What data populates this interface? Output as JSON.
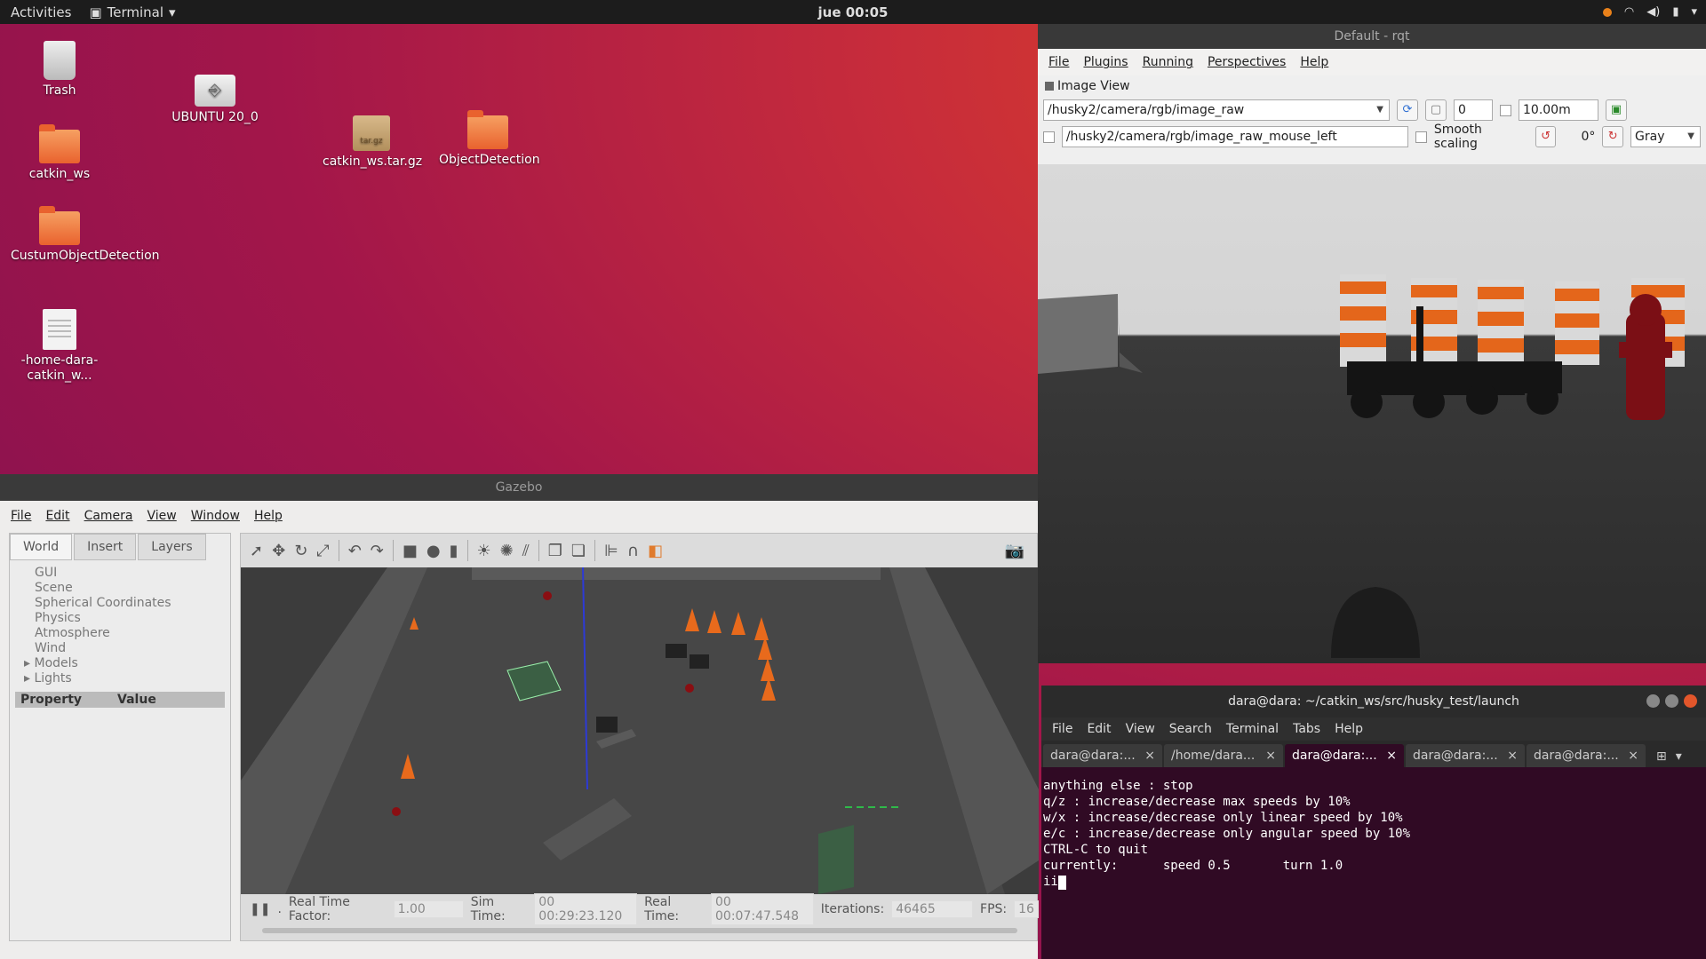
{
  "topbar": {
    "activities": "Activities",
    "app_name": "Terminal",
    "clock": "jue 00:05"
  },
  "desktop": {
    "icons": [
      {
        "label": "Trash"
      },
      {
        "label": "UBUNTU 20_0"
      },
      {
        "label": "catkin_ws.tar.gz"
      },
      {
        "label": "ObjectDetection"
      },
      {
        "label": "catkin_ws"
      },
      {
        "label": "CustumObjectDetection"
      },
      {
        "label": "-home-dara-catkin_w..."
      }
    ],
    "archive_badge": "tar.gz"
  },
  "rqt": {
    "title": "Default - rqt",
    "menu": [
      "File",
      "Plugins",
      "Running",
      "Perspectives",
      "Help"
    ],
    "plugin_title": "Image View",
    "topic": "/husky2/camera/rgb/image_raw",
    "spin_value": "0",
    "max_range": "10.00m",
    "mouse_topic": "/husky2/camera/rgb/image_raw_mouse_left",
    "smooth_scaling": "Smooth scaling",
    "rotation": "0°",
    "color_scheme": "Gray"
  },
  "gazebo": {
    "title": "Gazebo",
    "menu": [
      "File",
      "Edit",
      "Camera",
      "View",
      "Window",
      "Help"
    ],
    "tabs": [
      "World",
      "Insert",
      "Layers"
    ],
    "tree": [
      "GUI",
      "Scene",
      "Spherical Coordinates",
      "Physics",
      "Atmosphere",
      "Wind",
      "Models",
      "Lights"
    ],
    "prop_headers": [
      "Property",
      "Value"
    ],
    "status": {
      "rtf_label": "Real Time Factor:",
      "rtf": "1.00",
      "sim_label": "Sim Time:",
      "sim": "00 00:29:23.120",
      "real_label": "Real Time:",
      "real": "00 00:07:47.548",
      "iter_label": "Iterations:",
      "iter": "46465",
      "fps_label": "FPS:",
      "fps": "16"
    }
  },
  "terminal": {
    "title": "dara@dara: ~/catkin_ws/src/husky_test/launch",
    "menu": [
      "File",
      "Edit",
      "View",
      "Search",
      "Terminal",
      "Tabs",
      "Help"
    ],
    "tabs": [
      "dara@dara:...",
      "/home/dara...",
      "dara@dara:...",
      "dara@dara:...",
      "dara@dara:..."
    ],
    "lines": [
      "anything else : stop",
      "",
      "q/z : increase/decrease max speeds by 10%",
      "w/x : increase/decrease only linear speed by 10%",
      "e/c : increase/decrease only angular speed by 10%",
      "",
      "CTRL-C to quit",
      "",
      "currently:      speed 0.5       turn 1.0",
      "ii"
    ]
  }
}
